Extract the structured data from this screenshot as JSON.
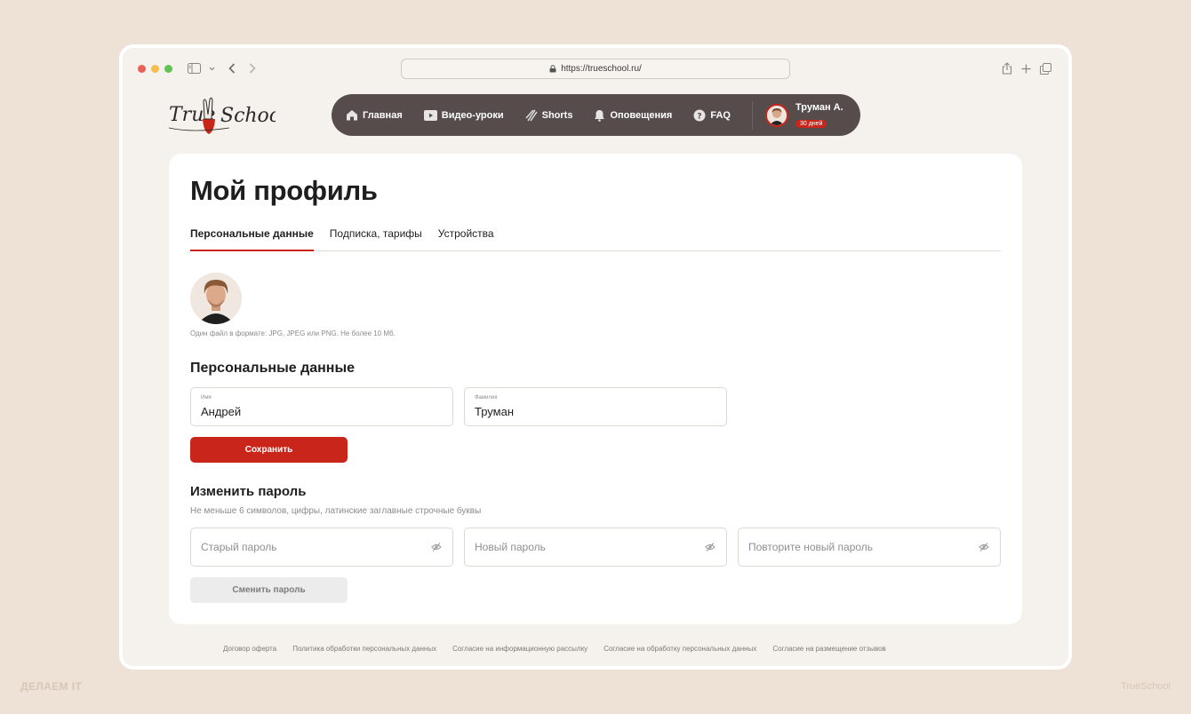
{
  "browser": {
    "url": "https://trueschool.ru/"
  },
  "logo": {
    "text": "TrueSchool"
  },
  "nav": {
    "items": [
      {
        "label": "Главная",
        "icon": "home-icon"
      },
      {
        "label": "Видео-уроки",
        "icon": "video-icon"
      },
      {
        "label": "Shorts",
        "icon": "shorts-icon"
      },
      {
        "label": "Оповещения",
        "icon": "bell-icon"
      },
      {
        "label": "FAQ",
        "icon": "help-icon"
      }
    ],
    "user": {
      "name": "Труман А.",
      "badge": "30 дней"
    }
  },
  "page": {
    "title": "Мой профиль",
    "tabs": [
      "Персональные данные",
      "Подписка, тарифы",
      "Устройства"
    ],
    "active_tab": "Персональные данные",
    "avatar_hint": "Один файл в формате: JPG, JPEG или PNG. Не более 10 Мб."
  },
  "personal": {
    "title": "Персональные данные",
    "first_name": {
      "label": "Имя",
      "value": "Андрей"
    },
    "last_name": {
      "label": "Фамилия",
      "value": "Труман"
    },
    "save_label": "Сохранить"
  },
  "password": {
    "title": "Изменить пароль",
    "hint": "Не меньше 6 символов, цифры, латинские заглавные строчные буквы",
    "old_placeholder": "Старый пароль",
    "new_placeholder": "Новый пароль",
    "repeat_placeholder": "Повторите новый пароль",
    "submit_label": "Сменить пароль"
  },
  "footer": {
    "links": [
      "Договор оферта",
      "Политика обработки персональных данных",
      "Согласие на информационную рассылку",
      "Согласие на обработку персональных данных",
      "Согласие на размещение отзывов"
    ]
  },
  "watermarks": {
    "left": "ДЕЛАЕМ IT",
    "right": "TrueSchool"
  },
  "colors": {
    "accent": "#c9251a",
    "nav_bg": "#574c4c",
    "page_bg": "#ede2d5"
  }
}
